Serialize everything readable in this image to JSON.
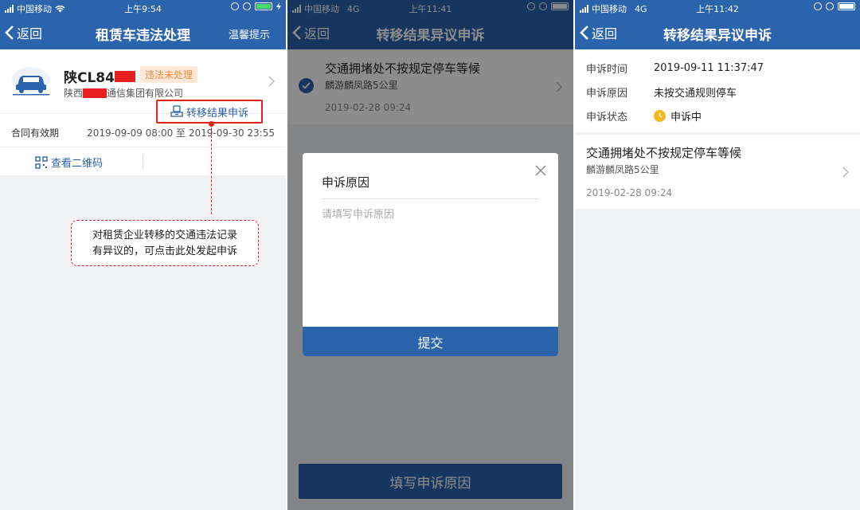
{
  "panel1": {
    "status": {
      "carrier": "中国移动",
      "time": "上午9:54"
    },
    "nav": {
      "back": "返回",
      "title": "租赁车违法处理",
      "right": "温馨提示"
    },
    "vehicle": {
      "plate_prefix": "陕CL84",
      "badge": "违法未处理",
      "company_prefix": "陕西",
      "company_suffix": "通信集团有限公司"
    },
    "contract": {
      "label": "合同有效期",
      "value": "2019-09-09 08:00 至 2019-09-30 23:55"
    },
    "actions": {
      "qr": "查看二维码",
      "appeal": "转移结果申诉"
    },
    "callout": {
      "line1": "对租赁企业转移的交通违法记录",
      "line2": "有异议的，可点击此处发起申诉"
    },
    "colors": {
      "primary": "#2b63ad",
      "badge_bg": "#fde8d6",
      "badge_text": "#f08a3c",
      "highlight": "#e0231f"
    }
  },
  "panel2": {
    "status": {
      "carrier": "中国移动",
      "network": "4G",
      "time": "上午11:41"
    },
    "nav": {
      "back": "返回",
      "title": "转移结果异议申诉"
    },
    "item": {
      "title": "交通拥堵处不按规定停车等候",
      "location": "麟游麟凤路5公里",
      "date": "2019-02-28 09:24"
    },
    "modal": {
      "title": "申诉原因",
      "placeholder": "请填写申诉原因",
      "submit": "提交"
    },
    "bottom_button": "填写申诉原因"
  },
  "panel3": {
    "status": {
      "carrier": "中国移动",
      "network": "4G",
      "time": "上午11:42"
    },
    "nav": {
      "back": "返回",
      "title": "转移结果异议申诉"
    },
    "info": {
      "time_label": "申诉时间",
      "time_value": "2019-09-11 11:37:47",
      "reason_label": "申诉原因",
      "reason_value": "未按交通规则停车",
      "state_label": "申诉状态",
      "state_value": "申诉中"
    },
    "item": {
      "title": "交通拥堵处不按规定停车等候",
      "location": "麟游麟凤路5公里",
      "date": "2019-02-28 09:24"
    }
  }
}
